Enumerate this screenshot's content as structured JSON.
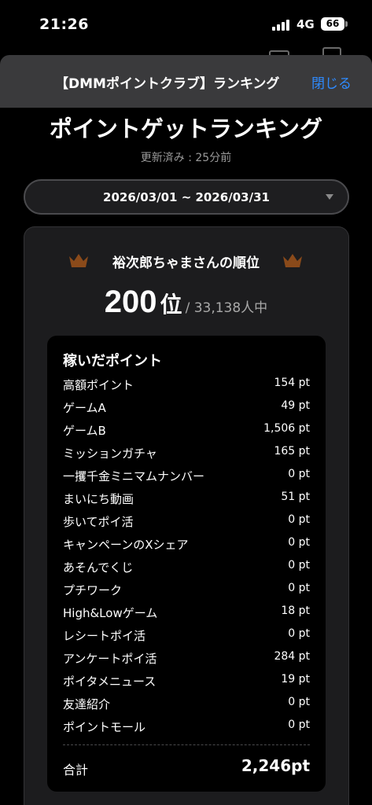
{
  "status_bar": {
    "time": "21:26",
    "network": "4G",
    "battery": "66"
  },
  "sheet": {
    "title": "【DMMポイントクラブ】ランキング",
    "close_label": "閉じる"
  },
  "page": {
    "title": "ポイントゲットランキング",
    "updated": "更新済み : 25分前"
  },
  "period_select": {
    "selected": "2026/03/01 ~ 2026/03/31"
  },
  "rank": {
    "label": "裕次郎ちゃまさんの順位",
    "position": "200",
    "unit": "位",
    "total": "/ 33,138人中"
  },
  "earned": {
    "title": "稼いだポイント",
    "rows": [
      {
        "label": "高額ポイント",
        "value": "154 pt"
      },
      {
        "label": "ゲームA",
        "value": "49 pt"
      },
      {
        "label": "ゲームB",
        "value": "1,506 pt"
      },
      {
        "label": "ミッションガチャ",
        "value": "165 pt"
      },
      {
        "label": "一攫千金ミニマムナンバー",
        "value": "0 pt"
      },
      {
        "label": "まいにち動画",
        "value": "51 pt"
      },
      {
        "label": "歩いてポイ活",
        "value": "0 pt"
      },
      {
        "label": "キャンペーンのXシェア",
        "value": "0 pt"
      },
      {
        "label": "あそんでくじ",
        "value": "0 pt"
      },
      {
        "label": "プチワーク",
        "value": "0 pt"
      },
      {
        "label": "High&Lowゲーム",
        "value": "18 pt"
      },
      {
        "label": "レシートポイ活",
        "value": "0 pt"
      },
      {
        "label": "アンケートポイ活",
        "value": "284 pt"
      },
      {
        "label": "ポイタメニュース",
        "value": "19 pt"
      },
      {
        "label": "友達紹介",
        "value": "0 pt"
      },
      {
        "label": "ポイントモール",
        "value": "0 pt"
      }
    ],
    "total_label": "合計",
    "total_value": "2,246pt"
  },
  "colors": {
    "background": "#000000",
    "card": "#1c1c1e",
    "sheet_header": "#3a3a3c",
    "link": "#2e8bff",
    "crown": "#8a4a1a"
  }
}
